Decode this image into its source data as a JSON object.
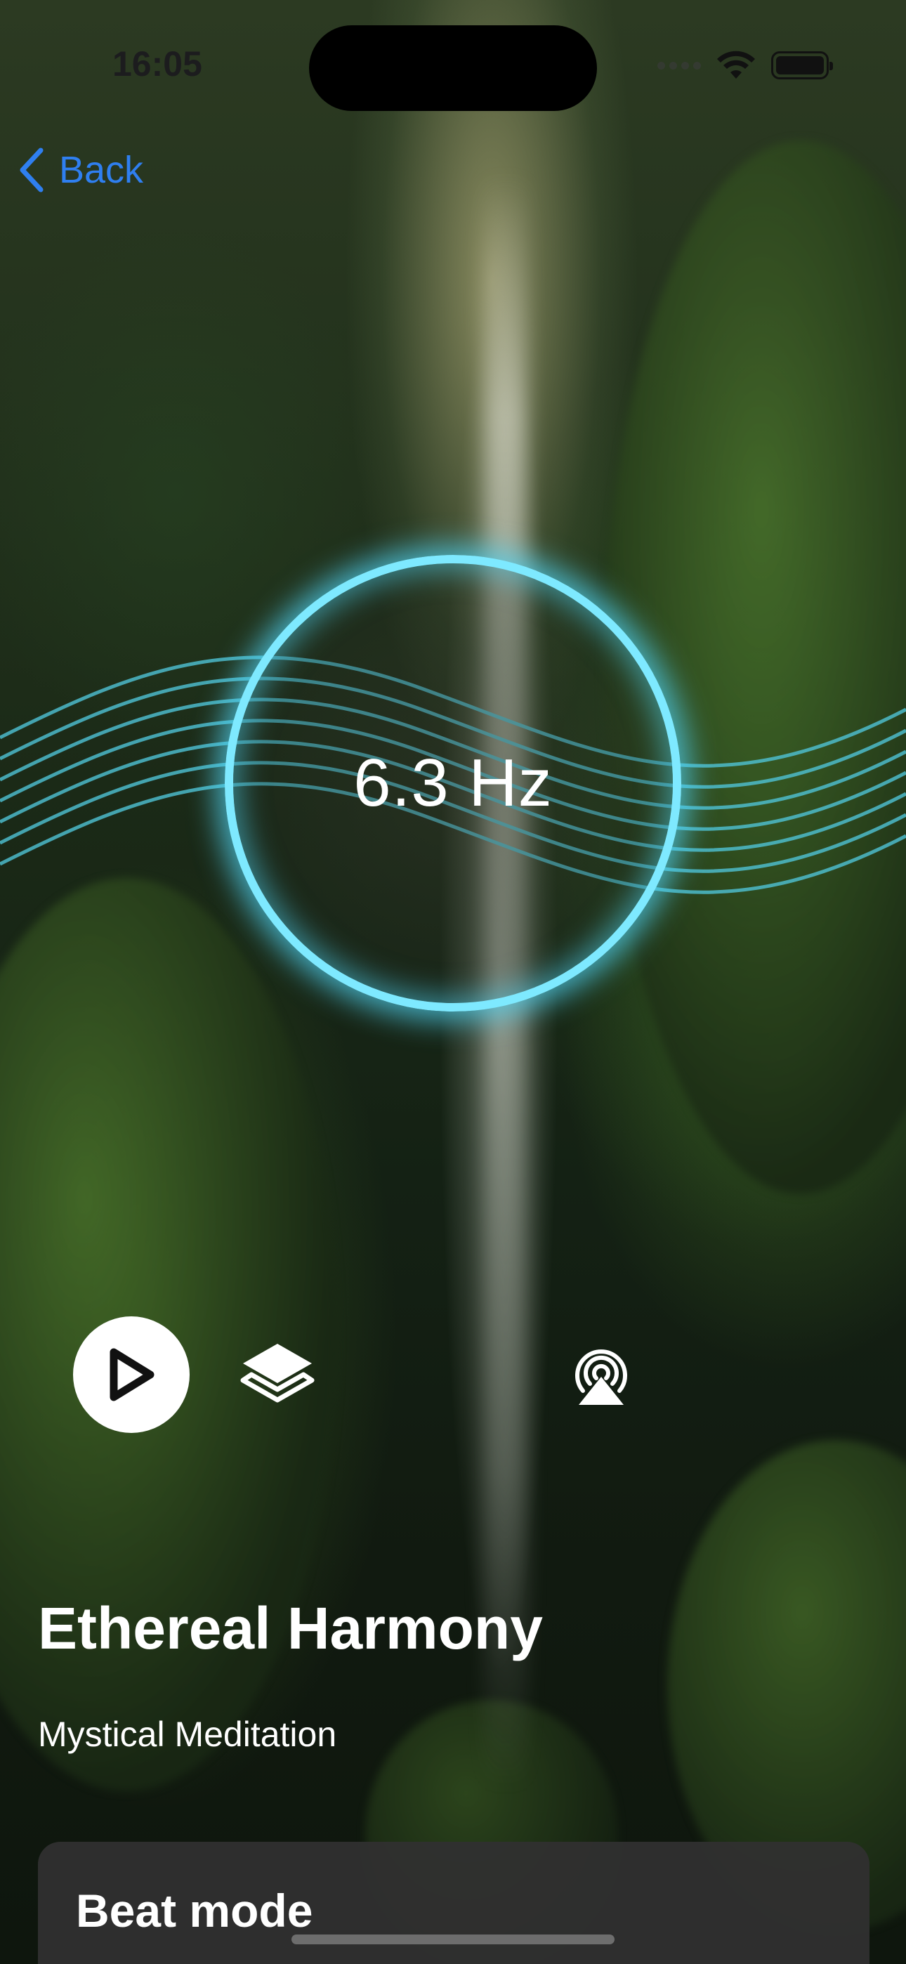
{
  "status_bar": {
    "time": "16:05",
    "icons": [
      "cellular-signal-icon",
      "wifi-icon",
      "battery-icon"
    ]
  },
  "nav": {
    "back_label": "Back",
    "back_icon": "chevron-left-icon"
  },
  "visualizer": {
    "frequency": "6.3 Hz",
    "ring_color": "#7ee9ff",
    "wave_color": "#4fc3d6"
  },
  "controls": {
    "play_icon": "play-icon",
    "layers_icon": "layers-icon",
    "airplay_icon": "airplay-icon"
  },
  "track": {
    "title": "Ethereal Harmony",
    "subtitle": "Mystical Meditation"
  },
  "sheet": {
    "title": "Beat mode"
  },
  "colors": {
    "accent": "#2f7ff0",
    "text": "#ffffff",
    "sheet_bg": "#303030"
  }
}
